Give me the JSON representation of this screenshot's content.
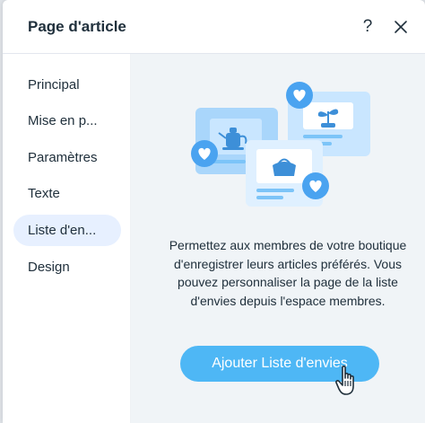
{
  "header": {
    "title": "Page d'article",
    "help_label": "?"
  },
  "sidebar": {
    "items": [
      {
        "label": "Principal"
      },
      {
        "label": "Mise en p..."
      },
      {
        "label": "Paramètres"
      },
      {
        "label": "Texte"
      },
      {
        "label": "Liste d'en...",
        "active": true
      },
      {
        "label": "Design"
      }
    ]
  },
  "main": {
    "description": "Permettez aux membres de votre boutique d'enregistrer leurs articles préférés. Vous pouvez personnaliser la page de la liste d'envies depuis l'espace membres.",
    "cta_label": "Ajouter Liste d'envies"
  },
  "colors": {
    "accent": "#4eb7f5",
    "active_item_bg": "#e7f0ff",
    "content_bg": "#f0f4f7",
    "heart_badge": "#4aa3f0",
    "card_fill": "#c9e6ff",
    "card_dark": "#7cc4f8"
  },
  "icons": [
    "help-icon",
    "close-icon",
    "heart-icon",
    "teapot-icon",
    "plant-icon",
    "bag-icon",
    "hand-pointer-icon"
  ]
}
